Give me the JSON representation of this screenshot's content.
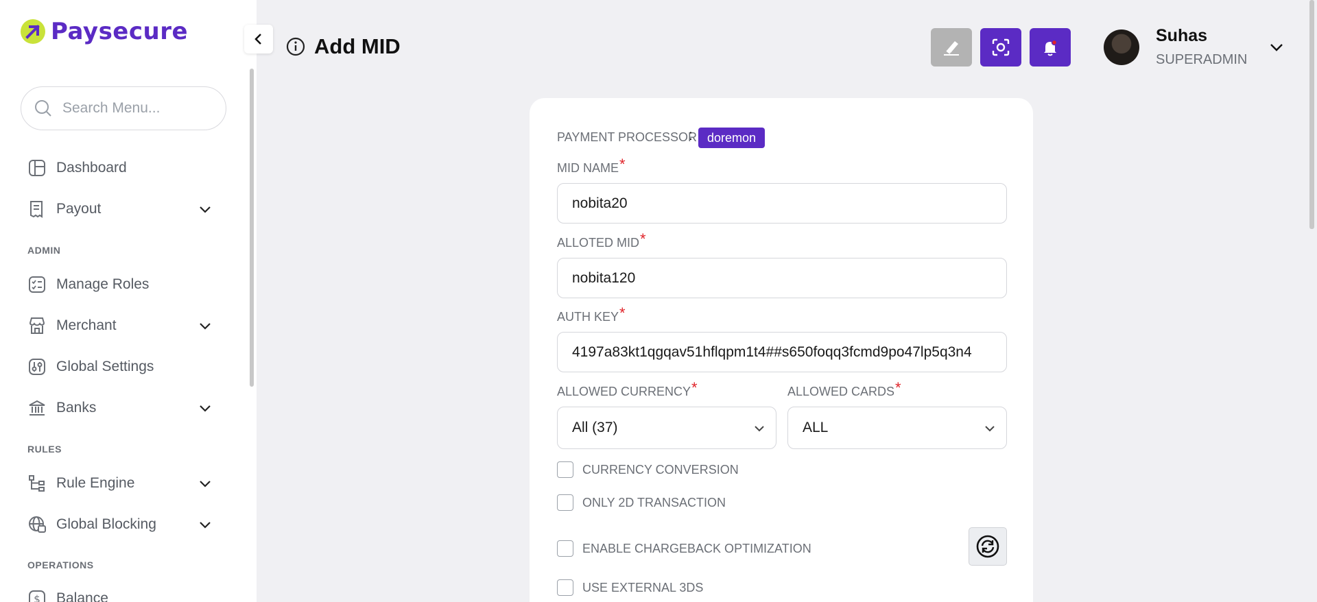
{
  "brand": {
    "name": "Paysecure",
    "accent": "#5b2bc4",
    "mark_color": "#c9e23a"
  },
  "sidebar": {
    "search_placeholder": "Search Menu...",
    "items": [
      {
        "label": "Dashboard",
        "icon": "dashboard-icon",
        "expandable": false
      },
      {
        "label": "Payout",
        "icon": "receipt-icon",
        "expandable": true
      },
      {
        "section": "ADMIN"
      },
      {
        "label": "Manage Roles",
        "icon": "checklist-icon",
        "expandable": false
      },
      {
        "label": "Merchant",
        "icon": "store-icon",
        "expandable": true
      },
      {
        "label": "Global Settings",
        "icon": "settings-sliders-icon",
        "expandable": false
      },
      {
        "label": "Banks",
        "icon": "bank-icon",
        "expandable": true
      },
      {
        "section": "RULES"
      },
      {
        "label": "Rule Engine",
        "icon": "hierarchy-icon",
        "expandable": true
      },
      {
        "label": "Global Blocking",
        "icon": "globe-block-icon",
        "expandable": true
      },
      {
        "section": "OPERATIONS"
      },
      {
        "label": "Balance",
        "icon": "dollar-icon",
        "expandable": false
      }
    ]
  },
  "header": {
    "title": "Add MID",
    "buttons": [
      {
        "name": "clear-button",
        "icon": "eraser-icon",
        "color": "#b3b3b3"
      },
      {
        "name": "screenshot-button",
        "icon": "scan-focus-icon",
        "color": "#5b2bc4"
      },
      {
        "name": "notifications-button",
        "icon": "bell-icon",
        "color": "#5b2bc4"
      }
    ],
    "user": {
      "name": "Suhas",
      "role": "SUPERADMIN"
    }
  },
  "form": {
    "processor_label": "PAYMENT PROCESSOR",
    "processor_value": "doremon",
    "mid_name": {
      "label": "MID NAME",
      "required": "*",
      "value": "nobita20"
    },
    "alloted_mid": {
      "label": "ALLOTED MID",
      "required": "*",
      "value": "nobita120"
    },
    "auth_key": {
      "label": "AUTH KEY",
      "required": "*",
      "value": "4197a83kt1qgqav51hflqpm1t4##s650foqq3fcmd9po47lp5q3n4"
    },
    "allowed_currency": {
      "label": "ALLOWED CURRENCY",
      "required": "*",
      "value": "All (37)"
    },
    "allowed_cards": {
      "label": "ALLOWED CARDS",
      "required": "*",
      "value": "ALL"
    },
    "checkboxes": [
      {
        "label": "CURRENCY CONVERSION",
        "checked": false
      },
      {
        "label": "ONLY 2D TRANSACTION",
        "checked": false
      },
      {
        "label": "ENABLE CHARGEBACK OPTIMIZATION",
        "checked": false
      },
      {
        "label": "USE EXTERNAL 3DS",
        "checked": false
      }
    ]
  }
}
